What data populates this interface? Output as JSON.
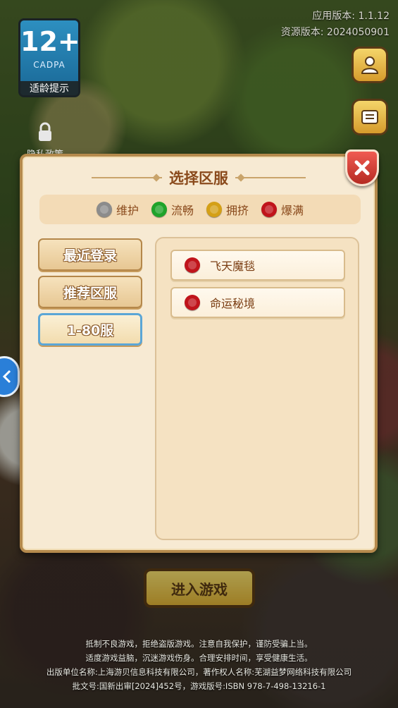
{
  "versions": {
    "app": "应用版本: 1.1.12",
    "resource": "资源版本: 2024050901"
  },
  "age_badge": {
    "rating": "12+",
    "org": "CADPA",
    "label": "适龄提示"
  },
  "privacy": {
    "label": "隐私政策"
  },
  "modal": {
    "title": "选择区服",
    "legend": [
      {
        "label": "维护",
        "color": "#8c8c8c"
      },
      {
        "label": "流畅",
        "color": "#1fa32a"
      },
      {
        "label": "拥挤",
        "color": "#d4a017"
      },
      {
        "label": "爆满",
        "color": "#c0141b"
      }
    ],
    "categories": [
      "最近登录",
      "推荐区服",
      "1-80服"
    ],
    "selected_category": "1-80服",
    "servers": [
      {
        "name": "飞天魔毯",
        "status": "爆满",
        "color": "#c0141b"
      },
      {
        "name": "命运秘境",
        "status": "爆满",
        "color": "#c0141b"
      }
    ]
  },
  "enter_button": "进入游戏",
  "footer": [
    "抵制不良游戏，拒绝盗版游戏。注意自我保护，谨防受骗上当。",
    "适度游戏益脑，沉迷游戏伤身。合理安排时间，享受健康生活。",
    "出版单位名称:上海游贝信息科技有限公司，著作权人名称:芜湖益梦网络科技有限公司",
    "批文号:国新出审[2024]452号，游戏版号:ISBN 978-7-498-13216-1"
  ]
}
